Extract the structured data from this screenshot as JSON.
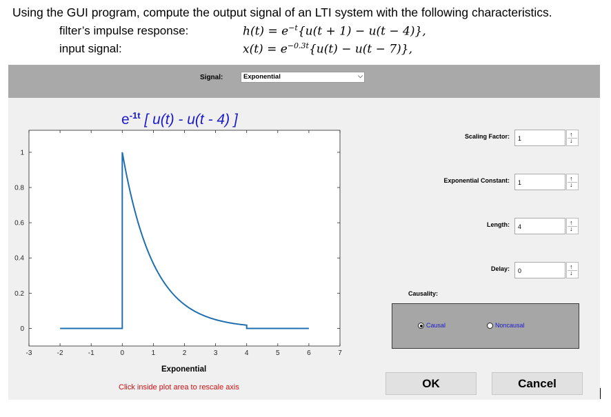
{
  "question": {
    "line1": "Using the GUI program, compute the output signal of an LTI system with the following characteristics.",
    "impulse_label": "filter’s impulse response:",
    "impulse_formula_pre": "h(t) = e",
    "impulse_formula_exp": "−t",
    "impulse_formula_post": "{u(t + 1) − u(t − 4)},",
    "input_label": "input signal:",
    "input_formula_pre": "x(t) = e",
    "input_formula_exp": "−0.3t",
    "input_formula_post": "{u(t) − u(t − 7)},"
  },
  "gui": {
    "signal_label": "Signal:",
    "signal_value": "Exponential",
    "formula_base": "e",
    "formula_exp": "-1t",
    "formula_rest": " [ u(t) - u(t - 4) ]",
    "xlabel": "Exponential",
    "hint": "Click inside plot area to rescale axis",
    "fields": [
      {
        "label": "Scaling Factor:",
        "value": "1"
      },
      {
        "label": "Exponential Constant:",
        "value": "1"
      },
      {
        "label": "Length:",
        "value": "4"
      },
      {
        "label": "Delay:",
        "value": "0"
      }
    ],
    "spin_up": "↑",
    "spin_down": "↓",
    "causality_label": "Causality:",
    "radio_causal": "Causal",
    "radio_noncausal": "Noncausal",
    "ok_label": "OK",
    "cancel_label": "Cancel"
  },
  "chart_data": {
    "type": "line",
    "xlabel": "Exponential",
    "xlim": [
      -3,
      7
    ],
    "ylim": [
      -0.1,
      1.125
    ],
    "xticks": [
      -3,
      -2,
      -1,
      0,
      1,
      2,
      3,
      4,
      5,
      6,
      7
    ],
    "yticks": [
      0,
      0.2,
      0.4,
      0.6,
      0.8,
      1
    ],
    "grid": false,
    "line_color": "#1f6fb0",
    "series": [
      {
        "function": "exp(-t) for 0<=t<=4, else 0",
        "x_range": [
          -2,
          6
        ]
      }
    ]
  }
}
